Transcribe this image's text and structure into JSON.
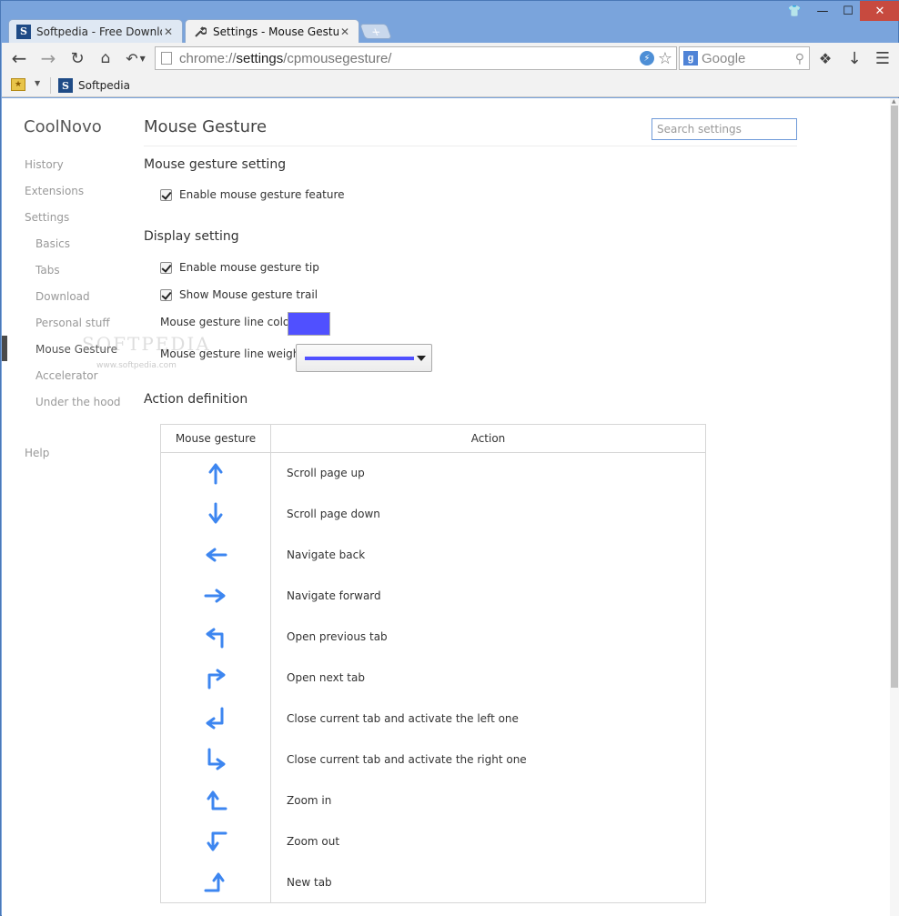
{
  "window": {
    "controls": {
      "shirt": "👕",
      "minimize": "—",
      "maximize": "☐",
      "close": "✕"
    }
  },
  "tabs": [
    {
      "title": "Softpedia - Free Downloads",
      "favicon": "S",
      "active": false
    },
    {
      "title": "Settings - Mouse Gesture",
      "favicon": "wrench-icon",
      "active": true
    }
  ],
  "toolbar": {
    "url_scheme": "chrome://",
    "url_host": "settings",
    "url_path": "/cpmousegesture/",
    "search_engine_label": "Google"
  },
  "bookmarks": {
    "items": [
      {
        "label": "Softpedia",
        "favicon": "S"
      }
    ]
  },
  "sidebar": {
    "brand": "CoolNovo",
    "items": [
      {
        "label": "History"
      },
      {
        "label": "Extensions"
      },
      {
        "label": "Settings"
      },
      {
        "label": "Basics"
      },
      {
        "label": "Tabs"
      },
      {
        "label": "Download"
      },
      {
        "label": "Personal stuff"
      },
      {
        "label": "Mouse Gesture"
      },
      {
        "label": "Accelerator"
      },
      {
        "label": "Under the hood"
      },
      {
        "label": "Help"
      }
    ],
    "active": "Mouse Gesture"
  },
  "main": {
    "title": "Mouse Gesture",
    "search_placeholder": "Search settings",
    "section_gesture": "Mouse gesture setting",
    "enable_gesture": {
      "label": "Enable mouse gesture feature",
      "checked": true
    },
    "section_display": "Display setting",
    "enable_tip": {
      "label": "Enable mouse gesture tip",
      "checked": true
    },
    "show_trail": {
      "label": "Show Mouse gesture trail",
      "checked": true
    },
    "line_color_label": "Mouse gesture line color",
    "line_color": "#5050ff",
    "line_weight_label": "Mouse gesture line weight",
    "section_actions": "Action definition",
    "table": {
      "col_gesture": "Mouse gesture",
      "col_action": "Action",
      "rows": [
        {
          "gesture": "arrow-up-icon",
          "action": "Scroll page up"
        },
        {
          "gesture": "arrow-down-icon",
          "action": "Scroll page down"
        },
        {
          "gesture": "arrow-left-icon",
          "action": "Navigate back"
        },
        {
          "gesture": "arrow-right-icon",
          "action": "Navigate forward"
        },
        {
          "gesture": "up-left-icon",
          "action": "Open previous tab"
        },
        {
          "gesture": "up-right-icon",
          "action": "Open next tab"
        },
        {
          "gesture": "down-left-icon",
          "action": "Close current tab and activate the left one"
        },
        {
          "gesture": "down-right-icon",
          "action": "Close current tab and activate the right one"
        },
        {
          "gesture": "left-up-icon",
          "action": "Zoom in"
        },
        {
          "gesture": "left-down-icon",
          "action": "Zoom out"
        },
        {
          "gesture": "right-up-icon",
          "action": "New tab"
        }
      ]
    }
  },
  "watermark": {
    "text": "SOFTPEDIA",
    "sub": "www.softpedia.com"
  },
  "colors": {
    "accent_arrow": "#3d86f0",
    "frame": "#7aa4dc"
  }
}
